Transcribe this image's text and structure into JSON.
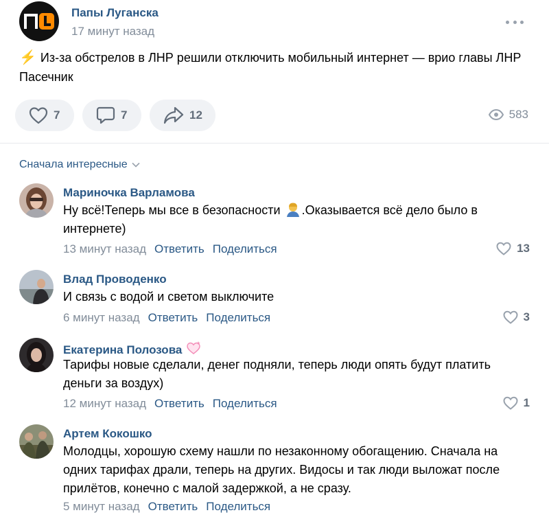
{
  "post": {
    "group_name": "Папы Луганска",
    "time": "17 минут назад",
    "text": "Из-за обстрелов в ЛНР решили отключить мобильный интернет — врио главы ЛНР Пасечник",
    "likes": "7",
    "comments": "7",
    "shares": "12",
    "views": "583"
  },
  "sort_label": "Сначала интересные",
  "labels": {
    "reply": "Ответить",
    "share": "Поделиться"
  },
  "comments": [
    {
      "name": "Мариночка Варламова",
      "text_before": "Ну всё!Теперь мы все в безопасности ",
      "text_after": ".Оказывается всё дело было в интернете)",
      "time": "13 минут назад",
      "likes": "13"
    },
    {
      "name": "Влад Проводенко",
      "text": "И связь с водой и светом выключите",
      "time": "6 минут назад",
      "likes": "3"
    },
    {
      "name": "Екатерина Полозова",
      "text": "Тарифы новые сделали, денег подняли, теперь люди опять будут платить деньги за воздух)",
      "time": "12 минут назад",
      "likes": "1"
    },
    {
      "name": "Артем Кокошко",
      "text": "Молодцы, хорошую схему нашли по незаконному обогащению. Сначала на одних тарифах драли, теперь на других. Видосы и так люди выложат после прилётов, конечно с малой задержкой, а не сразу.",
      "time": "5 минут назад"
    }
  ],
  "colors": {
    "link": "#2a5885",
    "meta": "#818c99",
    "pill_bg": "#f0f2f5",
    "logo_orange": "#ff8a00"
  }
}
